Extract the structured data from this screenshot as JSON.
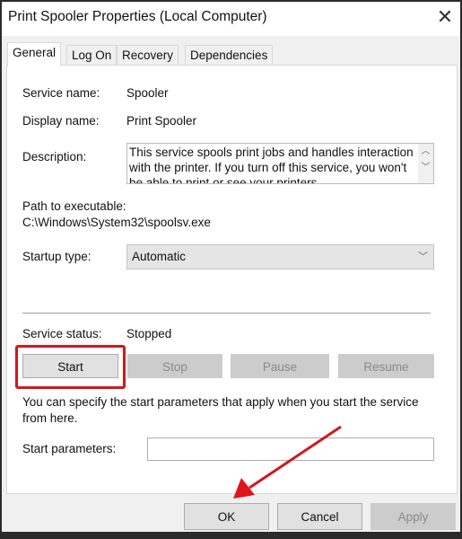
{
  "window": {
    "title": "Print Spooler Properties (Local Computer)",
    "close_icon": "close-icon"
  },
  "tabs": [
    {
      "label": "General",
      "selected": true
    },
    {
      "label": "Log On"
    },
    {
      "label": "Recovery"
    },
    {
      "label": "Dependencies"
    }
  ],
  "general": {
    "service_name_label": "Service name:",
    "service_name": "Spooler",
    "display_name_label": "Display name:",
    "display_name": "Print Spooler",
    "description_label": "Description:",
    "description": "This service spools print jobs and handles interaction with the printer.  If you turn off this service, you won't be able to print or see your printers.",
    "path_label": "Path to executable:",
    "path": "C:\\Windows\\System32\\spoolsv.exe",
    "startup_type_label": "Startup type:",
    "startup_type": "Automatic",
    "service_status_label": "Service status:",
    "service_status": "Stopped",
    "buttons": {
      "start": "Start",
      "stop": "Stop",
      "pause": "Pause",
      "resume": "Resume"
    },
    "hint": "You can specify the start parameters that apply when you start the service from here.",
    "start_params_label": "Start parameters:",
    "start_params_value": ""
  },
  "footer": {
    "ok": "OK",
    "cancel": "Cancel",
    "apply": "Apply"
  },
  "annotation_color": "#d0191e"
}
